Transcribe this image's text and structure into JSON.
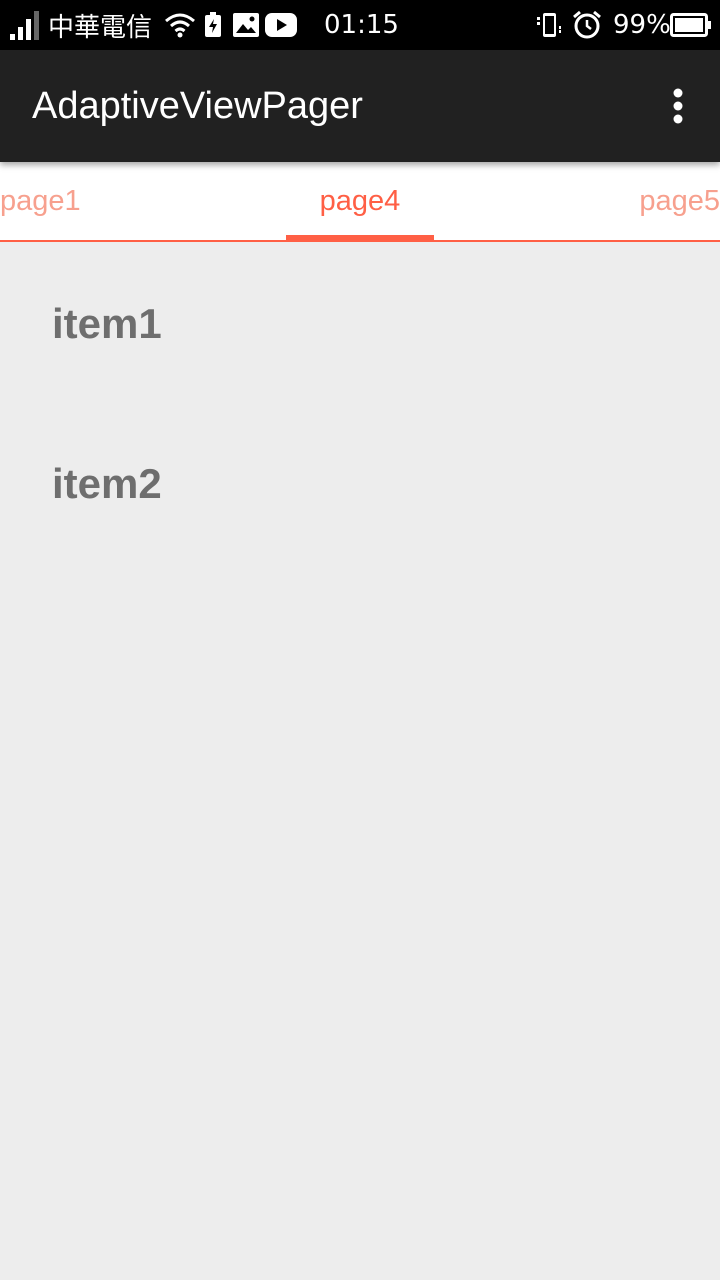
{
  "status_bar": {
    "carrier": "中華電信",
    "time": "01:15",
    "battery": "99%"
  },
  "app_bar": {
    "title": "AdaptiveViewPager",
    "overflow_icon": "more-vert-icon"
  },
  "tabs": [
    {
      "label": "page1",
      "active": false
    },
    {
      "label": "page4",
      "active": true
    },
    {
      "label": "page5",
      "active": false
    }
  ],
  "list": {
    "items": [
      {
        "label": "item1"
      },
      {
        "label": "item2"
      }
    ]
  },
  "colors": {
    "accent": "#ff5f45",
    "accent_faded": "#f7a08e",
    "app_bar": "#212121",
    "background": "#ededed"
  }
}
